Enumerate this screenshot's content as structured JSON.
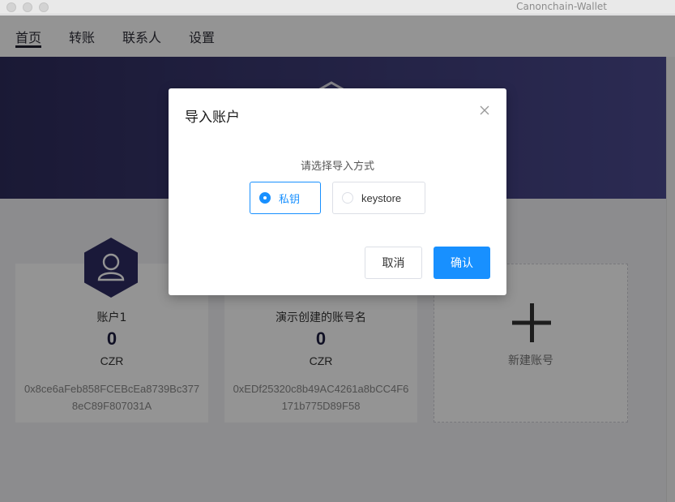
{
  "window": {
    "title": "Canonchain-Wallet"
  },
  "nav": {
    "items": [
      {
        "label": "首页",
        "active": true
      },
      {
        "label": "转账"
      },
      {
        "label": "联系人"
      },
      {
        "label": "设置"
      }
    ]
  },
  "accounts": [
    {
      "name": "账户1",
      "balance": "0",
      "unit": "CZR",
      "address": "0x8ce6aFeb858FCEBcEa8739Bc3778eC89F807031A"
    },
    {
      "name": "演示创建的账号名",
      "balance": "0",
      "unit": "CZR",
      "address": "0xEDf25320c8b49AC4261a8bCC4F6171b775D89F58"
    }
  ],
  "new_account": {
    "label": "新建账号"
  },
  "modal": {
    "title": "导入账户",
    "subtitle": "请选择导入方式",
    "options": [
      {
        "label": "私钥",
        "selected": true
      },
      {
        "label": "keystore",
        "selected": false
      }
    ],
    "cancel_label": "取消",
    "confirm_label": "确认"
  },
  "colors": {
    "accent": "#1890ff",
    "hero_start": "#2e2c5c",
    "hero_end": "#4b4a8f",
    "avatar": "#2e2c63"
  }
}
